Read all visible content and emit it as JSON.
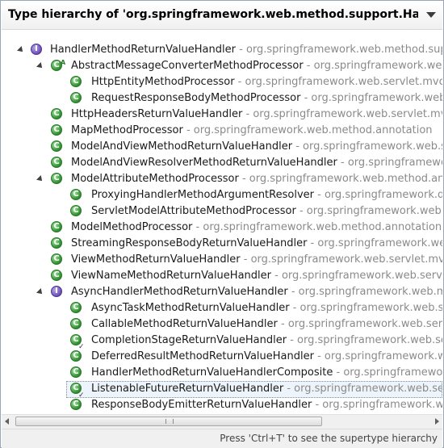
{
  "window": {
    "title": "Type hierarchy of 'org.springframework.web.method.support.HandlerMethodReturr"
  },
  "tree": [
    {
      "depth": 0,
      "kind": "interface",
      "twisty": "expanded",
      "name": "HandlerMethodReturnValueHandler",
      "pkg": " - org.springframework.web.method.support",
      "icon": "interface-icon"
    },
    {
      "depth": 1,
      "kind": "class",
      "twisty": "expanded",
      "abstract": true,
      "name": "AbstractMessageConverterMethodProcessor",
      "pkg": " - org.springframework.web.servl",
      "icon": "abstract-class-icon"
    },
    {
      "depth": 2,
      "kind": "class",
      "twisty": "none",
      "name": "HttpEntityMethodProcessor",
      "pkg": " - org.springframework.web.servlet.mvc.meth",
      "icon": "class-icon"
    },
    {
      "depth": 2,
      "kind": "class",
      "twisty": "none",
      "name": "RequestResponseBodyMethodProcessor",
      "pkg": " - org.springframework.web.s",
      "icon": "class-icon"
    },
    {
      "depth": 1,
      "kind": "class",
      "twisty": "none",
      "name": "HttpHeadersReturnValueHandler",
      "pkg": " - org.springframework.web.servlet.mvc.metho",
      "icon": "class-icon"
    },
    {
      "depth": 1,
      "kind": "class",
      "twisty": "none",
      "name": "MapMethodProcessor",
      "pkg": " - org.springframework.web.method.annotation",
      "icon": "class-icon"
    },
    {
      "depth": 1,
      "kind": "class",
      "twisty": "none",
      "name": "ModelAndViewMethodReturnValueHandler",
      "pkg": " - org.springframework.web.servlet",
      "icon": "class-icon"
    },
    {
      "depth": 1,
      "kind": "class",
      "twisty": "none",
      "name": "ModelAndViewResolverMethodReturnValueHandler",
      "pkg": " - org.springframework.web",
      "icon": "class-icon"
    },
    {
      "depth": 1,
      "kind": "class",
      "twisty": "expanded",
      "name": "ModelAttributeMethodProcessor",
      "pkg": " - org.springframework.web.method.annotati",
      "icon": "class-icon"
    },
    {
      "depth": 2,
      "kind": "class",
      "twisty": "none",
      "name": "ProxyingHandlerMethodArgumentResolver",
      "pkg": " - org.springframework.data.we",
      "icon": "class-icon"
    },
    {
      "depth": 2,
      "kind": "class",
      "twisty": "none",
      "name": "ServletModelAttributeMethodProcessor",
      "pkg": " - org.springframework.web.servle",
      "icon": "class-icon"
    },
    {
      "depth": 1,
      "kind": "class",
      "twisty": "none",
      "name": "ModelMethodProcessor",
      "pkg": " - org.springframework.web.method.annotation",
      "icon": "class-icon"
    },
    {
      "depth": 1,
      "kind": "class",
      "twisty": "none",
      "name": "StreamingResponseBodyReturnValueHandler",
      "pkg": " - org.springframework.web.servl",
      "icon": "class-icon"
    },
    {
      "depth": 1,
      "kind": "class",
      "twisty": "none",
      "name": "ViewMethodReturnValueHandler",
      "pkg": " - org.springframework.web.servlet.mvc.meth",
      "icon": "class-icon"
    },
    {
      "depth": 1,
      "kind": "class",
      "twisty": "none",
      "name": "ViewNameMethodReturnValueHandler",
      "pkg": " - org.springframework.web.servlet.mvc.",
      "icon": "class-icon"
    },
    {
      "depth": 1,
      "kind": "interface",
      "twisty": "expanded",
      "name": "AsyncHandlerMethodReturnValueHandler",
      "pkg": " - org.springframework.web.method.",
      "icon": "interface-icon"
    },
    {
      "depth": 2,
      "kind": "class",
      "twisty": "none",
      "name": "AsyncTaskMethodReturnValueHandler",
      "pkg": " - org.springframework.web.servlet.",
      "icon": "class-icon"
    },
    {
      "depth": 2,
      "kind": "class",
      "twisty": "none",
      "name": "CallableMethodReturnValueHandler",
      "pkg": " - org.springframework.web.servlet.mv",
      "icon": "class-icon"
    },
    {
      "depth": 2,
      "kind": "class",
      "twisty": "none",
      "deprecated": true,
      "name": "CompletionStageReturnValueHandler",
      "pkg": " - org.springframework.web.servlet.m",
      "icon": "deprecated-class-icon"
    },
    {
      "depth": 2,
      "kind": "class",
      "twisty": "none",
      "name": "DeferredResultMethodReturnValueHandler",
      "pkg": " - org.springframework.web.se",
      "icon": "class-icon"
    },
    {
      "depth": 2,
      "kind": "class",
      "twisty": "none",
      "name": "HandlerMethodReturnValueHandlerComposite",
      "pkg": " - org.springframework.web",
      "icon": "class-icon"
    },
    {
      "depth": 2,
      "kind": "class",
      "twisty": "none",
      "deprecated": true,
      "selected": true,
      "name": "ListenableFutureReturnValueHandler",
      "pkg": " - org.springframework.web.servlet.mv",
      "icon": "deprecated-class-icon"
    },
    {
      "depth": 2,
      "kind": "class",
      "twisty": "none",
      "name": "ResponseBodyEmitterReturnValueHandler",
      "pkg": " - org.springframework.web.se",
      "icon": "class-icon"
    }
  ],
  "status": {
    "hint": "Press 'Ctrl+T' to see the supertype hierarchy"
  }
}
